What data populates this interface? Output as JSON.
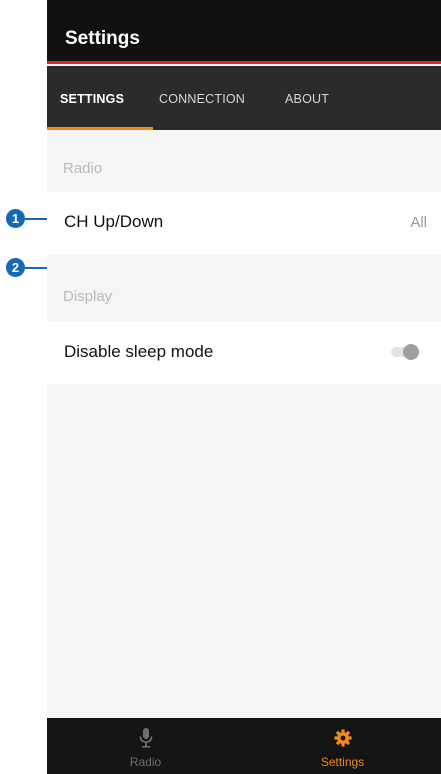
{
  "annotations": {
    "callout_1": "1",
    "callout_2": "2"
  },
  "appbar": {
    "title": "Settings"
  },
  "tabs": [
    {
      "label": "SETTINGS",
      "active": true
    },
    {
      "label": "CONNECTION",
      "active": false
    },
    {
      "label": "ABOUT",
      "active": false
    }
  ],
  "sections": {
    "radio": {
      "header": "Radio",
      "ch_updown": {
        "label": "CH Up/Down",
        "value": "All"
      }
    },
    "display": {
      "header": "Display",
      "sleep_mode": {
        "label": "Disable sleep mode",
        "enabled": false
      }
    }
  },
  "bottom_nav": {
    "radio": {
      "label": "Radio",
      "icon": "microphone-icon"
    },
    "settings": {
      "label": "Settings",
      "icon": "gear-icon",
      "active": true
    }
  },
  "colors": {
    "accent": "#f08a1a",
    "appbar_underline": "#e02424",
    "callout": "#1669b3"
  }
}
